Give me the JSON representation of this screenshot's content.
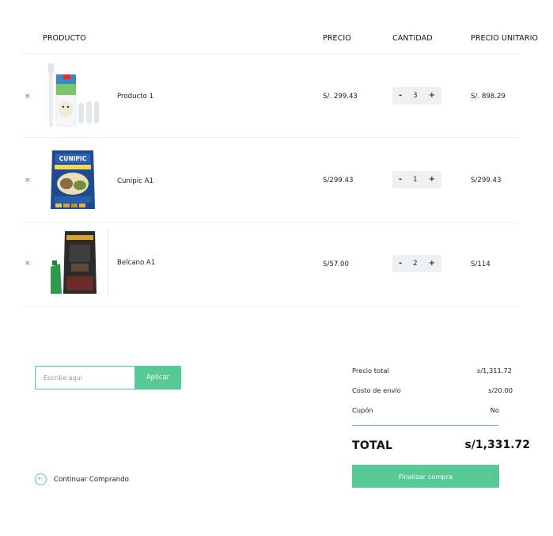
{
  "headers": {
    "product": "PRODUCTO",
    "price": "PRECIO",
    "quantity": "CANTIDAD",
    "unit_price": "PRECIO UNITARIO"
  },
  "items": [
    {
      "remove": "×",
      "name": "Producto 1",
      "price": "S/. 299.43",
      "quantity": "3",
      "unit_price": "S/. 898.29"
    },
    {
      "remove": "×",
      "name": "Cunipic A1",
      "price": "S/299.43",
      "quantity": "1",
      "unit_price": "S/299.43"
    },
    {
      "remove": "×",
      "name": "Belcano A1",
      "price": "S/57.00",
      "quantity": "2",
      "unit_price": "S/114"
    }
  ],
  "qty_controls": {
    "minus": "-",
    "plus": "+"
  },
  "coupon": {
    "placeholder": "Escribe aqui",
    "apply_label": "Aplicar"
  },
  "continue": {
    "arrow": "←",
    "label": "Continuar Comprando"
  },
  "summary": {
    "subtotal_label": "Precio total",
    "subtotal_value": "s/1,311.72",
    "shipping_label": "Costo de envío",
    "shipping_value": "s/20.00",
    "coupon_label": "Cupón",
    "coupon_value": "No",
    "total_label": "TOTAL",
    "total_value": "s/1,331.72",
    "checkout_label": "Finalizar compra"
  },
  "colors": {
    "accent": "#56c995",
    "remove": "#e14a4a",
    "qty_bg": "#eef0f1"
  }
}
